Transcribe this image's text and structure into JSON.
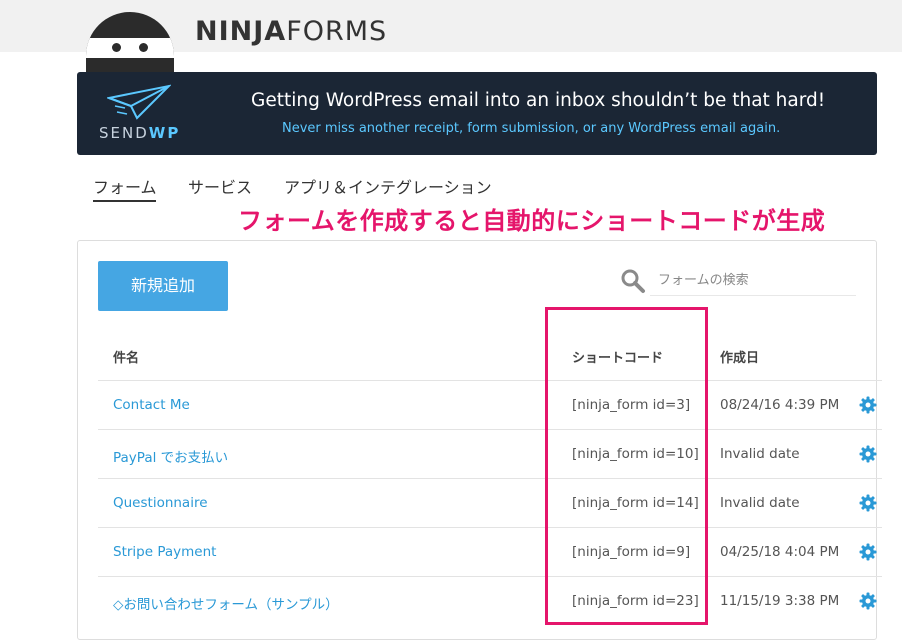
{
  "header": {
    "brand_bold": "NINJA",
    "brand_light": "FORMS"
  },
  "banner": {
    "logo_send": "SEND",
    "logo_wp": "WP",
    "title": "Getting WordPress email into an inbox shouldn’t be that hard!",
    "subtitle": "Never miss another receipt, form submission, or any WordPress email again."
  },
  "tabs": [
    {
      "label": "フォーム",
      "active": true
    },
    {
      "label": "サービス",
      "active": false
    },
    {
      "label": "アプリ＆インテグレーション",
      "active": false
    }
  ],
  "callout": "フォームを作成すると自動的にショートコードが生成",
  "toolbar": {
    "add_label": "新規追加",
    "search_placeholder": "フォームの検索"
  },
  "table": {
    "columns": [
      "件名",
      "ショートコード",
      "作成日"
    ],
    "rows": [
      {
        "name": "Contact Me",
        "shortcode": "[ninja_form id=3]",
        "date": "08/24/16 4:39 PM"
      },
      {
        "name": "PayPal でお支払い",
        "shortcode": "[ninja_form id=10]",
        "date": "Invalid date"
      },
      {
        "name": "Questionnaire",
        "shortcode": "[ninja_form id=14]",
        "date": "Invalid date"
      },
      {
        "name": "Stripe Payment",
        "shortcode": "[ninja_form id=9]",
        "date": "04/25/18 4:04 PM"
      },
      {
        "name": "◇お問い合わせフォーム（サンプル）",
        "shortcode": "[ninja_form id=23]",
        "date": "11/15/19 3:38 PM"
      }
    ]
  },
  "colors": {
    "accent": "#45a6e3",
    "link": "#2a99d6",
    "highlight": "#e5156b",
    "banner_bg": "#1b2635"
  },
  "icons": {
    "search": "search-icon",
    "row_action": "gear-icon",
    "logo": "ninja-logo-icon",
    "plane": "paper-plane-icon"
  }
}
